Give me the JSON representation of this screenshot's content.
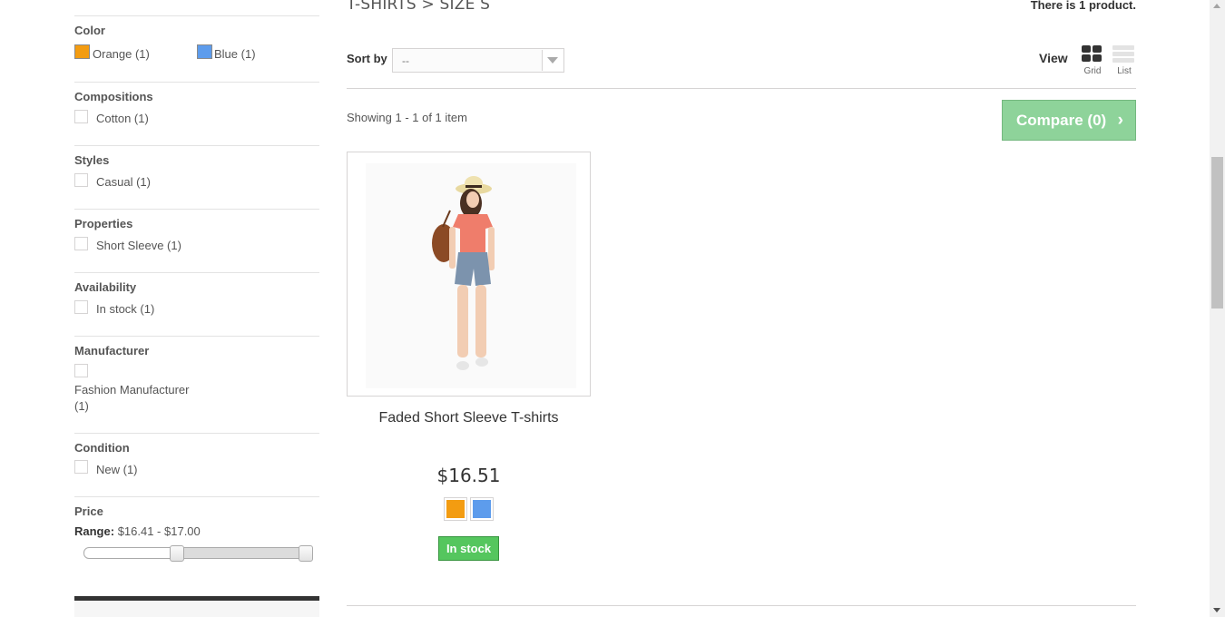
{
  "header": {
    "category_title": "T-SHIRTS > SIZE S",
    "product_count": "There is 1 product."
  },
  "filters": {
    "color": {
      "title": "Color",
      "items": [
        {
          "label": "Orange (1)",
          "color": "#f39c11"
        },
        {
          "label": "Blue (1)",
          "color": "#5d9cec"
        }
      ]
    },
    "compositions": {
      "title": "Compositions",
      "items": [
        {
          "label": "Cotton (1)"
        }
      ]
    },
    "styles": {
      "title": "Styles",
      "items": [
        {
          "label": "Casual (1)"
        }
      ]
    },
    "properties": {
      "title": "Properties",
      "items": [
        {
          "label": "Short Sleeve (1)"
        }
      ]
    },
    "availability": {
      "title": "Availability",
      "items": [
        {
          "label": "In stock (1)"
        }
      ]
    },
    "manufacturer": {
      "title": "Manufacturer",
      "items": [
        {
          "label_line1": "Fashion Manufacturer",
          "label_line2": "(1)"
        }
      ]
    },
    "condition": {
      "title": "Condition",
      "items": [
        {
          "label": "New (1)"
        }
      ]
    },
    "price": {
      "title": "Price",
      "range_label": "Range:",
      "range_value": "$16.41 - $17.00",
      "slider_min_fraction": 0.4,
      "slider_max_fraction": 1.0
    }
  },
  "toolbar": {
    "sort_label": "Sort by",
    "sort_value": "--",
    "view_label": "View",
    "view_grid": "Grid",
    "view_list": "List",
    "showing": "Showing 1 - 1 of 1 item",
    "compare_label": "Compare (0)"
  },
  "product": {
    "name": "Faded Short Sleeve T-shirts",
    "price": "$16.51",
    "colors": [
      "#f39c11",
      "#5d9cec"
    ],
    "stock": "In stock",
    "stock_color": "#55c65e"
  },
  "theme": {
    "compare_button_color": "#8ed39a"
  }
}
